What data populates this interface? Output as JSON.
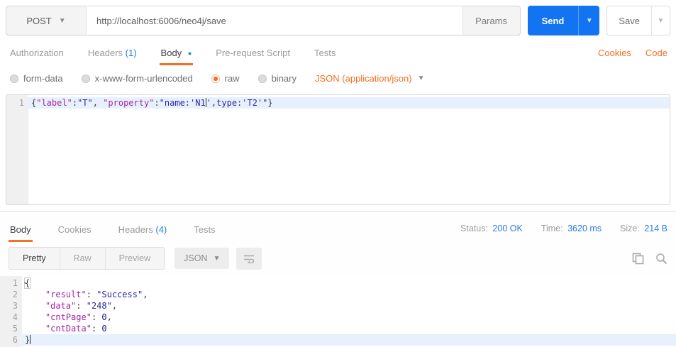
{
  "request_bar": {
    "method": "POST",
    "url": "http://localhost:6006/neo4j/save",
    "params_label": "Params",
    "send_label": "Send",
    "save_label": "Save"
  },
  "request_tabs": {
    "items": [
      {
        "label": "Authorization"
      },
      {
        "label": "Headers",
        "count": "(1)"
      },
      {
        "label": "Body",
        "dot": "●",
        "active": true
      },
      {
        "label": "Pre-request Script"
      },
      {
        "label": "Tests"
      }
    ],
    "cookies_label": "Cookies",
    "code_label": "Code"
  },
  "body_type_row": {
    "options": [
      "form-data",
      "x-www-form-urlencoded",
      "raw",
      "binary"
    ],
    "selected": "raw",
    "content_type": "JSON (application/json)"
  },
  "request_editor": {
    "lines": [
      {
        "num": "1",
        "active": true,
        "tokens": [
          {
            "text": "{",
            "type": "punc"
          },
          {
            "text": "\"label\"",
            "type": "key"
          },
          {
            "text": ":",
            "type": "punc"
          },
          {
            "text": "\"T\"",
            "type": "str"
          },
          {
            "text": ", ",
            "type": "punc"
          },
          {
            "text": "\"property\"",
            "type": "key"
          },
          {
            "text": ":",
            "type": "punc"
          },
          {
            "text": "\"name:'N1",
            "type": "str"
          },
          {
            "text": "",
            "type": "caret"
          },
          {
            "text": "',type:'T2'\"",
            "type": "str"
          },
          {
            "text": "}",
            "type": "punc"
          }
        ]
      }
    ]
  },
  "response_tabs": {
    "items": [
      {
        "label": "Body",
        "active": true
      },
      {
        "label": "Cookies"
      },
      {
        "label": "Headers",
        "count": "(4)"
      },
      {
        "label": "Tests"
      }
    ],
    "meta": [
      {
        "label": "Status:",
        "value": "200 OK"
      },
      {
        "label": "Time:",
        "value": "3620 ms"
      },
      {
        "label": "Size:",
        "value": "214 B"
      }
    ]
  },
  "response_toolbar": {
    "views": [
      "Pretty",
      "Raw",
      "Preview"
    ],
    "active_view": "Pretty",
    "language": "JSON"
  },
  "response_editor": {
    "lines": [
      {
        "num": "1",
        "fold": "▾",
        "tokens": [
          {
            "text": "{",
            "type": "punc",
            "bracket": true
          }
        ]
      },
      {
        "num": "2",
        "tokens": [
          {
            "text": "    ",
            "type": "punc"
          },
          {
            "text": "\"result\"",
            "type": "key"
          },
          {
            "text": ": ",
            "type": "punc"
          },
          {
            "text": "\"Success\"",
            "type": "str"
          },
          {
            "text": ",",
            "type": "punc"
          }
        ]
      },
      {
        "num": "3",
        "tokens": [
          {
            "text": "    ",
            "type": "punc"
          },
          {
            "text": "\"data\"",
            "type": "key"
          },
          {
            "text": ": ",
            "type": "punc"
          },
          {
            "text": "\"248\"",
            "type": "str"
          },
          {
            "text": ",",
            "type": "punc"
          }
        ]
      },
      {
        "num": "4",
        "tokens": [
          {
            "text": "    ",
            "type": "punc"
          },
          {
            "text": "\"cntPage\"",
            "type": "key"
          },
          {
            "text": ": ",
            "type": "punc"
          },
          {
            "text": "0",
            "type": "num"
          },
          {
            "text": ",",
            "type": "punc"
          }
        ]
      },
      {
        "num": "5",
        "tokens": [
          {
            "text": "    ",
            "type": "punc"
          },
          {
            "text": "\"cntData\"",
            "type": "key"
          },
          {
            "text": ": ",
            "type": "punc"
          },
          {
            "text": "0",
            "type": "num"
          }
        ]
      },
      {
        "num": "6",
        "active": true,
        "tokens": [
          {
            "text": "}",
            "type": "punc"
          },
          {
            "text": "",
            "type": "caret"
          }
        ]
      }
    ]
  }
}
